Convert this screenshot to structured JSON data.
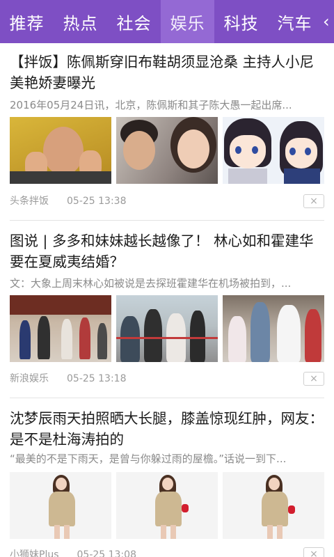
{
  "tabs": [
    {
      "label": "推荐",
      "active": false
    },
    {
      "label": "热点",
      "active": false
    },
    {
      "label": "社会",
      "active": false
    },
    {
      "label": "娱乐",
      "active": true
    },
    {
      "label": "科技",
      "active": false
    },
    {
      "label": "汽车",
      "active": false
    }
  ],
  "articles": [
    {
      "title": "【拌饭】陈佩斯穿旧布鞋胡须显沧桑 主持人小尼美艳娇妻曝光",
      "summary": "2016年05月24日讯，北京，陈佩斯和其子陈大愚一起出席...",
      "source": "头条拌饭",
      "time": "05-25 13:38",
      "dismiss": "×"
    },
    {
      "title": "图说 | 多多和妹妹越长越像了！ 林心如和霍建华要在夏威夷结婚？",
      "summary": "文：大象上周末林心如被说是去探班霍建华在机场被拍到，...",
      "source": "新浪娱乐",
      "time": "05-25 13:18",
      "dismiss": "×"
    },
    {
      "title": "沈梦辰雨天拍照晒大长腿，膝盖惊现红肿，网友：是不是杜海涛拍的",
      "summary": "“最美的不是下雨天，是曾与你躲过雨的屋檐。”话说一到下...",
      "source": "小狮妹Plus",
      "time": "05-25 13:08",
      "dismiss": "×"
    }
  ],
  "colors": {
    "tabbar": "#7e4fc4",
    "tab_active": "#9469d4"
  }
}
